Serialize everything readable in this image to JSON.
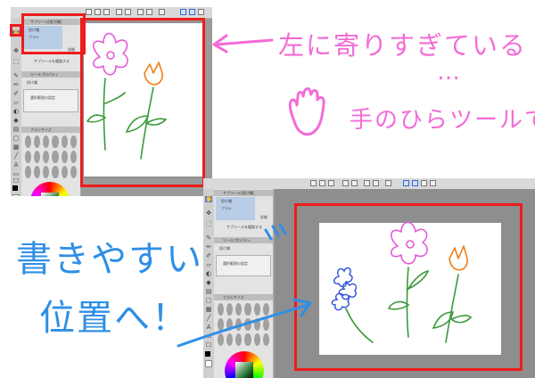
{
  "top_screenshot": {
    "panel_title": "サブツール[投げ縄]",
    "layer_1": "投げ縄",
    "layer_2": "ブラシ",
    "option_button": "詳細",
    "sub_button": "サブツールを複製する",
    "tool_property_title": "ツールプロパティ",
    "tool_property_name": "投げ縄",
    "tool_property_row": "選択範囲の設定",
    "brush_size_title": "ブラシサイズ"
  },
  "bottom_screenshot": {
    "panel_title": "サブツール[投げ縄]",
    "layer_1": "投げ縄",
    "layer_2": "ブラシ",
    "option_button": "詳細",
    "sub_button": "サブツールを複製する",
    "tool_property_title": "ツールプロパティ",
    "tool_property_name": "投げ縄",
    "tool_property_row": "選択範囲の設定",
    "brush_size_title": "ブラシサイズ"
  },
  "annotations": {
    "too_far_left": "左に寄りすぎている",
    "ellipsis": "…",
    "hand_tool": "手のひらツールで",
    "easy_to_draw": "書きやすい",
    "to_position": "位置へ！"
  },
  "colors": {
    "highlight_red": "#ee1c1c",
    "annotation_pink": "#f36bd7",
    "annotation_blue": "#2f8fe6",
    "flower_pink": "#e55ad9",
    "tulip_orange": "#f07f1a",
    "stem_green": "#3a9a3a",
    "flower_blue": "#2a4fd9"
  }
}
